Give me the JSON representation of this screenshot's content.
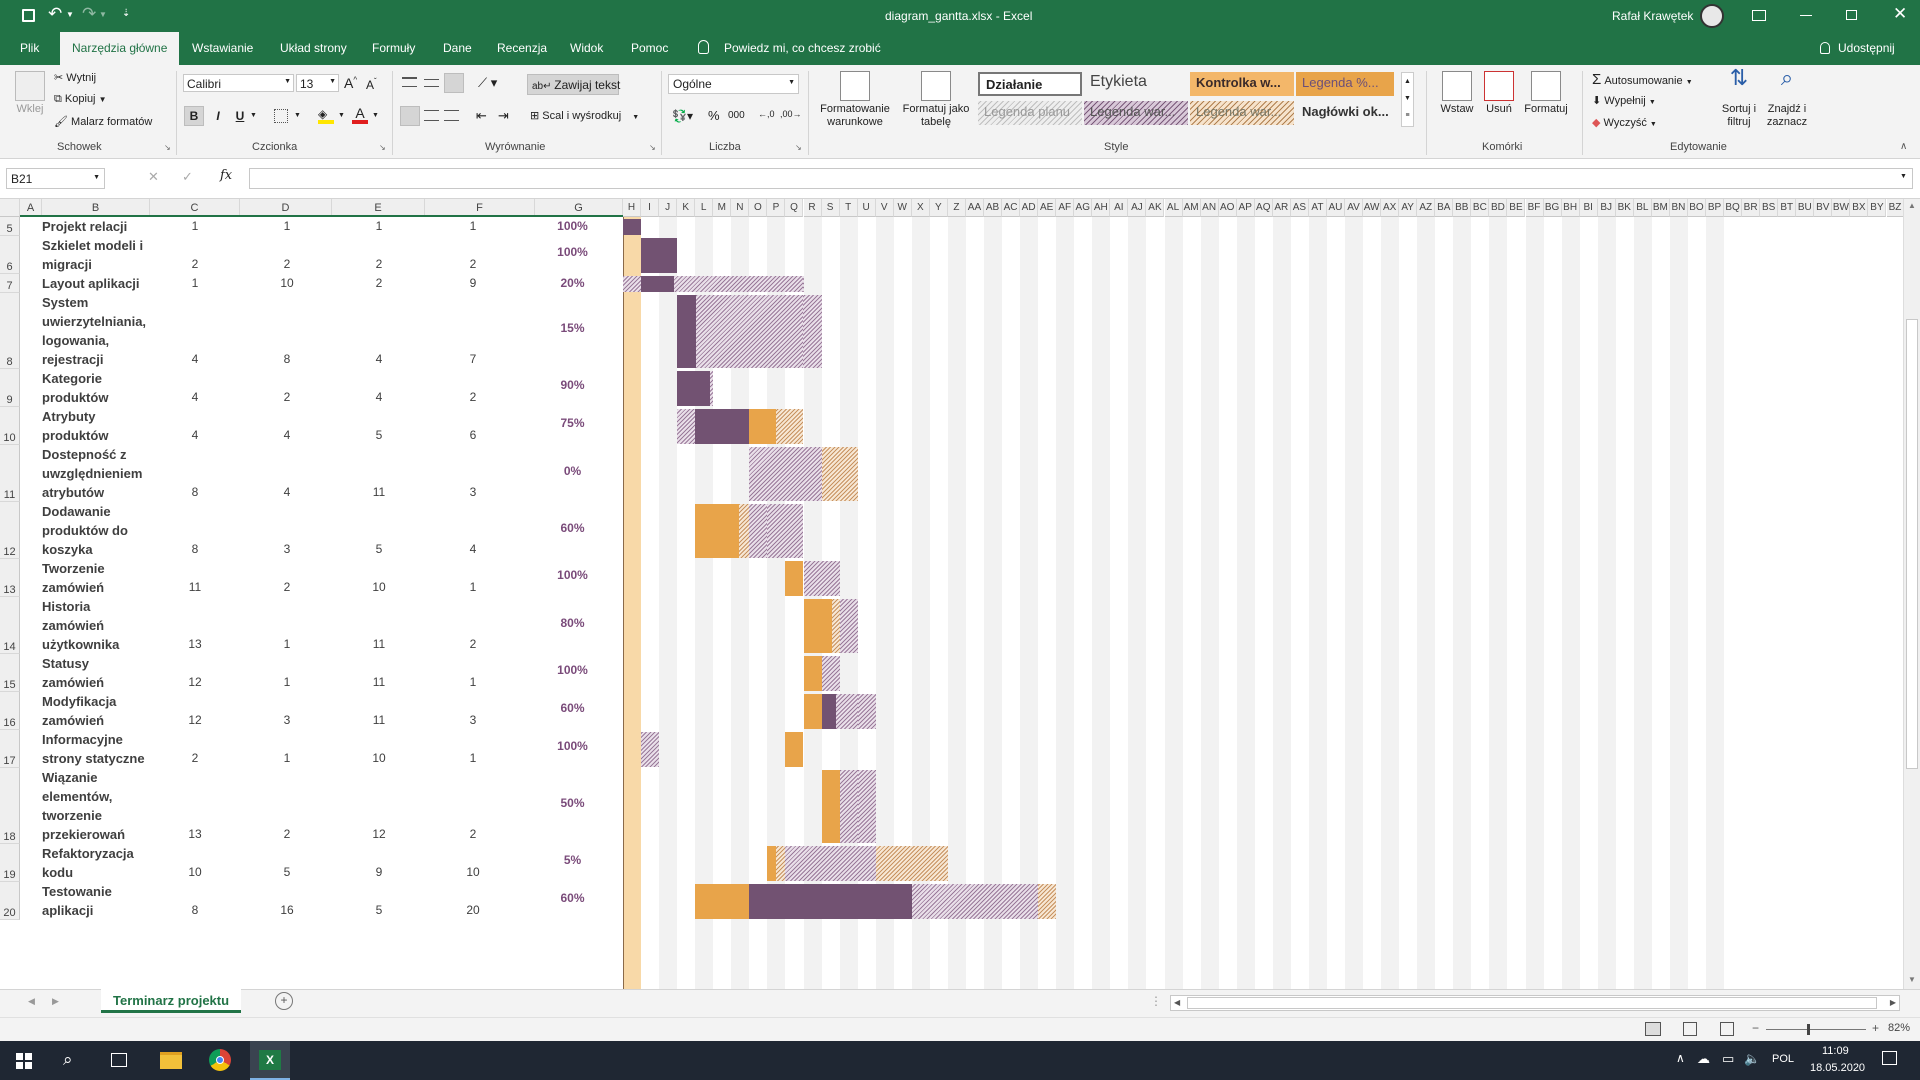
{
  "title_bar": {
    "file": "diagram_gantta.xlsx  -  Excel",
    "user": "Rafał Krawętek"
  },
  "tabs": [
    "Plik",
    "Narzędzia główne",
    "Wstawianie",
    "Układ strony",
    "Formuły",
    "Dane",
    "Recenzja",
    "Widok",
    "Pomoc"
  ],
  "active_tab": "Narzędzia główne",
  "tell_me": "Powiedz mi, co chcesz zrobić",
  "share": "Udostępnij",
  "ribbon": {
    "clipboard": {
      "paste": "Wklej",
      "cut": "Wytnij",
      "copy": "Kopiuj",
      "painter": "Malarz formatów",
      "label": "Schowek"
    },
    "font": {
      "name": "Calibri",
      "size": "13",
      "label": "Czcionka",
      "bold": "B",
      "italic": "I",
      "underline": "U"
    },
    "alignment": {
      "wrap": "Zawijaj tekst",
      "merge": "Scal i wyśrodkuj",
      "label": "Wyrównanie"
    },
    "number": {
      "format": "Ogólne",
      "label": "Liczba"
    },
    "styles": {
      "cond": "Formatowanie warunkowe",
      "table": "Formatuj jako tabelę",
      "label": "Style",
      "cells": [
        "Działanie",
        "Etykieta",
        "Kontrolka w...",
        "Legenda %...",
        "Legenda planu",
        "Legenda war...",
        "Legenda war...",
        "Nagłówki ok..."
      ]
    },
    "cells": {
      "insert": "Wstaw",
      "delete": "Usuń",
      "format": "Formatuj",
      "label": "Komórki"
    },
    "editing": {
      "autosum": "Autosumowanie",
      "fill": "Wypełnij",
      "clear": "Wyczyść",
      "sort": "Sortuj i filtruj",
      "find": "Znajdź i zaznacz",
      "label": "Edytowanie"
    }
  },
  "name_box": "B21",
  "columns_left": [
    "A",
    "B",
    "C",
    "D",
    "E",
    "F",
    "G"
  ],
  "columns_gantt": [
    "H",
    "I",
    "J",
    "K",
    "L",
    "M",
    "N",
    "O",
    "P",
    "Q",
    "R",
    "S",
    "T",
    "U",
    "V",
    "W",
    "X",
    "Y",
    "Z",
    "AA",
    "AB",
    "AC",
    "AD",
    "AE",
    "AF",
    "AG",
    "AH",
    "AI",
    "AJ",
    "AK",
    "AL",
    "AM",
    "AN",
    "AO",
    "AP",
    "AQ",
    "AR",
    "AS",
    "AT",
    "AU",
    "AV",
    "AW",
    "AX",
    "AY",
    "AZ",
    "BA",
    "BB",
    "BC",
    "BD",
    "BE",
    "BF",
    "BG",
    "BH",
    "BI",
    "BJ",
    "BK",
    "BL",
    "BM",
    "BN",
    "BO",
    "BP",
    "BQ",
    "BR",
    "BS",
    "BT",
    "BU",
    "BV",
    "BW",
    "BX",
    "BY",
    "BZ"
  ],
  "rows": [
    {
      "n": "5",
      "task": "Projekt relacji",
      "c": "1",
      "d": "1",
      "e": "1",
      "f": "1",
      "pct": "100%"
    },
    {
      "n": "6",
      "task": "Szkielet modeli i migracji",
      "c": "2",
      "d": "2",
      "e": "2",
      "f": "2",
      "pct": "100%"
    },
    {
      "n": "7",
      "task": "Layout aplikacji",
      "c": "1",
      "d": "10",
      "e": "2",
      "f": "9",
      "pct": "20%"
    },
    {
      "n": "8",
      "task": "System uwierzytelniania, logowania, rejestracji",
      "c": "4",
      "d": "8",
      "e": "4",
      "f": "7",
      "pct": "15%"
    },
    {
      "n": "9",
      "task": "Kategorie produktów",
      "c": "4",
      "d": "2",
      "e": "4",
      "f": "2",
      "pct": "90%"
    },
    {
      "n": "10",
      "task": "Atrybuty produktów",
      "c": "4",
      "d": "4",
      "e": "5",
      "f": "6",
      "pct": "75%"
    },
    {
      "n": "11",
      "task": "Dostepność z uwzględnieniem atrybutów",
      "c": "8",
      "d": "4",
      "e": "11",
      "f": "3",
      "pct": "0%"
    },
    {
      "n": "12",
      "task": "Dodawanie produktów do koszyka",
      "c": "8",
      "d": "3",
      "e": "5",
      "f": "4",
      "pct": "60%"
    },
    {
      "n": "13",
      "task": "Tworzenie zamówień",
      "c": "11",
      "d": "2",
      "e": "10",
      "f": "1",
      "pct": "100%"
    },
    {
      "n": "14",
      "task": "Historia zamówień użytkownika",
      "c": "13",
      "d": "1",
      "e": "11",
      "f": "2",
      "pct": "80%"
    },
    {
      "n": "15",
      "task": "Statusy zamówień",
      "c": "12",
      "d": "1",
      "e": "11",
      "f": "1",
      "pct": "100%"
    },
    {
      "n": "16",
      "task": "Modyfikacja zamówień",
      "c": "12",
      "d": "3",
      "e": "11",
      "f": "3",
      "pct": "60%"
    },
    {
      "n": "17",
      "task": "Informacyjne strony statyczne",
      "c": "2",
      "d": "1",
      "e": "10",
      "f": "1",
      "pct": "100%"
    },
    {
      "n": "18",
      "task": "Wiązanie elementów, tworzenie przekierowań",
      "c": "13",
      "d": "2",
      "e": "12",
      "f": "2",
      "pct": "50%"
    },
    {
      "n": "19",
      "task": "Refaktoryzacja kodu",
      "c": "10",
      "d": "5",
      "e": "9",
      "f": "10",
      "pct": "5%"
    },
    {
      "n": "20",
      "task": "Testowanie aplikacji",
      "c": "8",
      "d": "16",
      "e": "5",
      "f": "20",
      "pct": "60%"
    }
  ],
  "sheet_tab": "Terminarz projektu",
  "zoom": "82%",
  "taskbar": {
    "lang": "POL",
    "time": "11:09",
    "date": "18.05.2020"
  },
  "colors": {
    "excel_green": "#217346",
    "plan_purple": "#725272",
    "actual_orange": "#e8a44a"
  }
}
